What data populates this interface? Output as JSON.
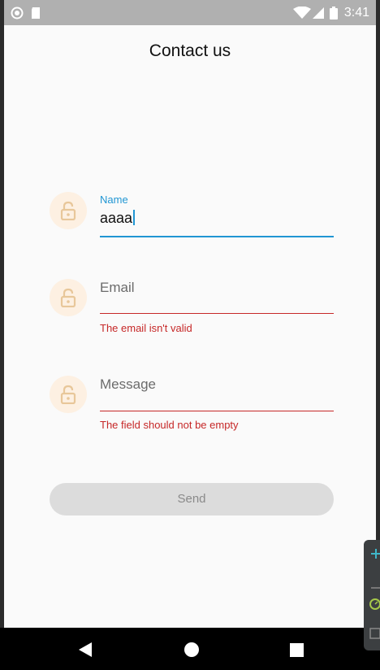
{
  "status_bar": {
    "time": "3:41",
    "icons": [
      "circle-icon",
      "sd-card-icon",
      "wifi-icon",
      "signal-icon",
      "battery-icon"
    ]
  },
  "header": {
    "title": "Contact us"
  },
  "form": {
    "name": {
      "label": "Name",
      "value": "aaaa",
      "focused": true,
      "icon": "lock-icon"
    },
    "email": {
      "placeholder": "Email",
      "error": "The email isn't valid",
      "icon": "lock-icon"
    },
    "message": {
      "placeholder": "Message",
      "error": "The field should not be empty",
      "icon": "lock-icon"
    },
    "send_label": "Send"
  },
  "nav_bar": {
    "icons": [
      "back-icon",
      "home-icon",
      "recents-icon"
    ]
  },
  "colors": {
    "accent": "#2196d3",
    "error": "#c62828",
    "icon_tint": "#e8c79a",
    "icon_bg": "#fdf0e2"
  }
}
